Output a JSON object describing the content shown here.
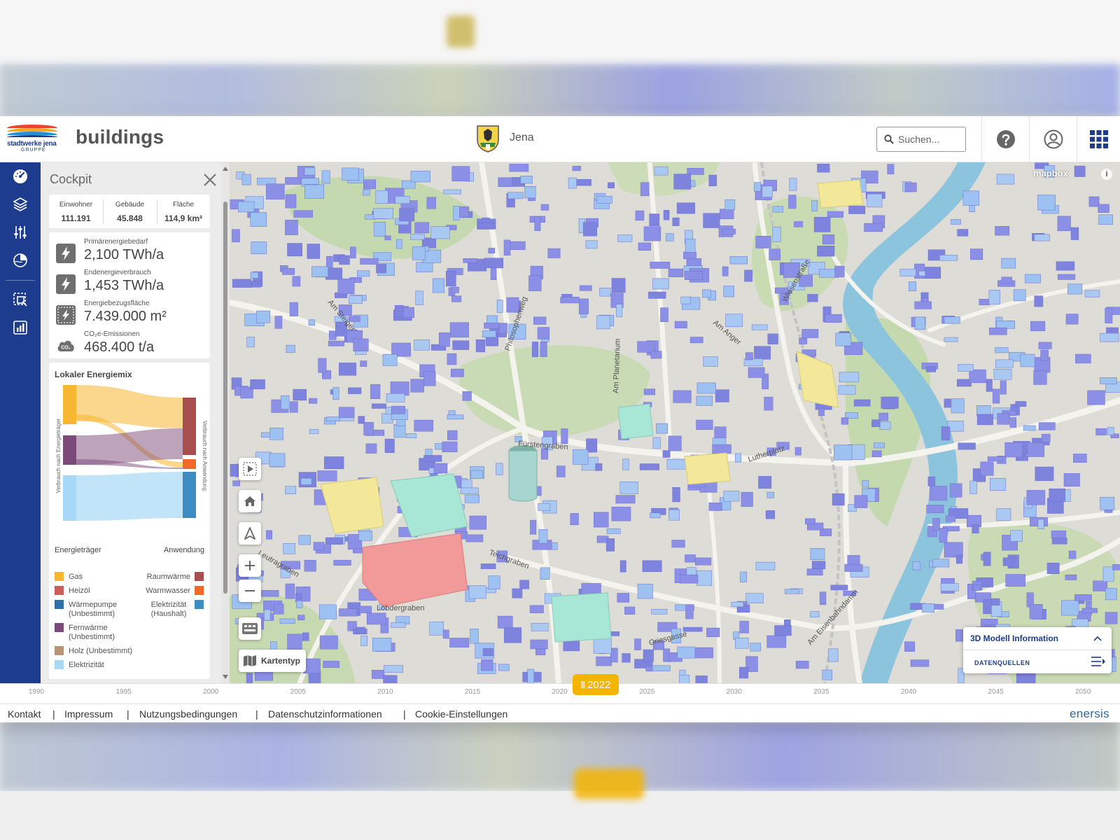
{
  "header": {
    "logo_name": "stadtwerke jena",
    "logo_sub": "GRUPPE",
    "title": "buildings",
    "city": "Jena",
    "search_placeholder": "Suchen..."
  },
  "cockpit": {
    "title": "Cockpit",
    "kpis": [
      {
        "label": "Einwohner",
        "value": "111.191"
      },
      {
        "label": "Gebäude",
        "value": "45.848"
      },
      {
        "label": "Fläche",
        "value": "114,9 km²"
      }
    ],
    "energy": [
      {
        "label": "Primärenergiebedarf",
        "value": "2,100 TWh/a"
      },
      {
        "label": "Endenergieverbrauch",
        "value": "1,453 TWh/a"
      },
      {
        "label": "Energiebezugsfläche",
        "value": "7.439.000 m²"
      },
      {
        "label": "CO₂e-Emissionen",
        "value": "468.400 t/a"
      }
    ],
    "co2_icon_label": "CO₂",
    "mix": {
      "title": "Lokaler Energiemix",
      "left_axis": "Verbrauch nach Energieträger",
      "right_axis": "Verbrauch nach Anwendung",
      "carriers_header": "Energieträger",
      "uses_header": "Anwendung",
      "carriers": [
        {
          "label": "Gas",
          "color": "#f7b731"
        },
        {
          "label": "Heizöl",
          "color": "#cd5c5c"
        },
        {
          "label": "Wärmepumpe (Unbestimmt)",
          "color": "#2e6fa7"
        },
        {
          "label": "Fernwärme (Unbestimmt)",
          "color": "#7b4a78"
        },
        {
          "label": "Holz (Unbestimmt)",
          "color": "#b99375"
        },
        {
          "label": "Elektrizität",
          "color": "#a7d8f5"
        }
      ],
      "uses": [
        {
          "label": "Raumwärme",
          "color": "#a84e4e"
        },
        {
          "label": "Warmwasser",
          "color": "#f06a2a"
        },
        {
          "label": "Elektrizität (Haushalt)",
          "color": "#3d8cc4"
        }
      ]
    }
  },
  "map": {
    "attribution": "mapbox",
    "info": "i",
    "map_type_label": "Kartentyp",
    "model_info_title": "3D Modell Information",
    "datasources_label": "DATENQUELLEN",
    "streets": [
      "Fürstengraben",
      "Lutherplatz",
      "Am Anger",
      "Teichgraben",
      "Am Eisenbahndamm",
      "Griesgasse",
      "Wiesenstraße",
      "Philosophenweg",
      "Am Planetarium",
      "Am Steiger",
      "Leutragraben",
      "Löbdergraben"
    ]
  },
  "timeline": {
    "years": [
      "1990",
      "1995",
      "2000",
      "2005",
      "2010",
      "2015",
      "2020",
      "2025",
      "2030",
      "2035",
      "2040",
      "2045",
      "2050"
    ],
    "current": "2022"
  },
  "footer": {
    "links": [
      "Kontakt",
      "Impressum",
      "Nutzungsbedingungen",
      "Datenschutzinformationen",
      "Cookie-Einstellungen"
    ],
    "brand": "enersis"
  },
  "colors": {
    "brand_blue": "#1d3c8e",
    "timeline_accent": "#f5b400",
    "building_blue": "#8b8fe6",
    "building_light_blue": "#9dc1f0",
    "building_yellow": "#f3e79a",
    "building_red": "#f29a9a",
    "building_mint": "#a8e6d6"
  }
}
